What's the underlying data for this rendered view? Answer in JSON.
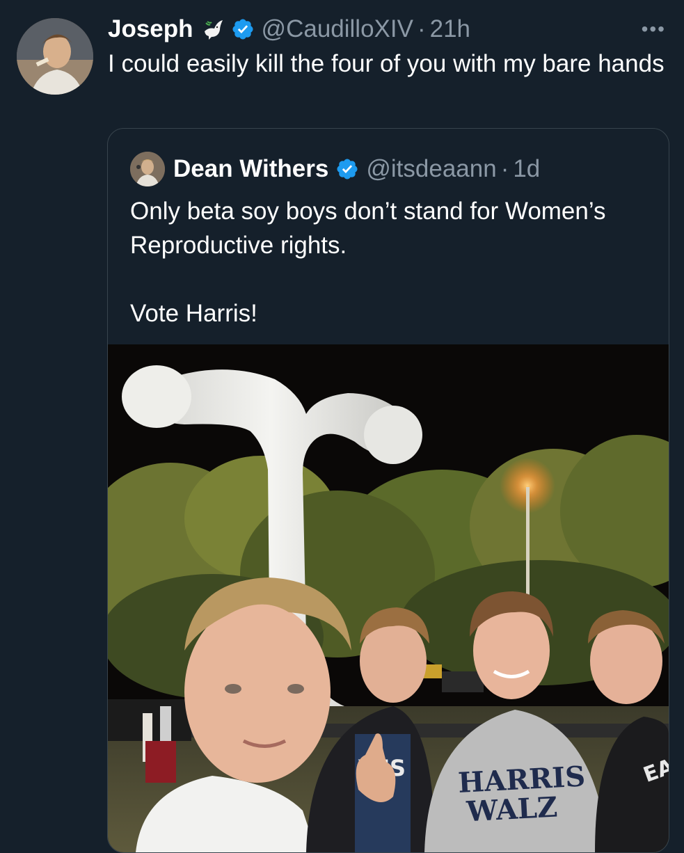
{
  "tweet": {
    "author_name": "Joseph",
    "handle": "@CaudilloXIV",
    "separator": "·",
    "time": "21h",
    "more": "•••",
    "text": "I could easily kill the four of you with my bare hands"
  },
  "quote": {
    "author_name": "Dean Withers",
    "handle": "@itsdeaann",
    "separator": "·",
    "time": "1d",
    "line1": "Only beta soy boys don’t stand for Women’s Reproductive rights.",
    "line2": "Vote Harris!",
    "sweatshirt_text": "HARRIS WALZ",
    "shirt_partial_text": "YES",
    "shirt_partial_text_2": "EA"
  },
  "colors": {
    "background": "#15202b",
    "secondary_text": "#8b98a5",
    "verified": "#1d9bf0",
    "border": "#38444d"
  },
  "icons": {
    "dove": "dove-emoji-icon",
    "verified": "verified-badge-icon",
    "more": "more-options-icon"
  }
}
